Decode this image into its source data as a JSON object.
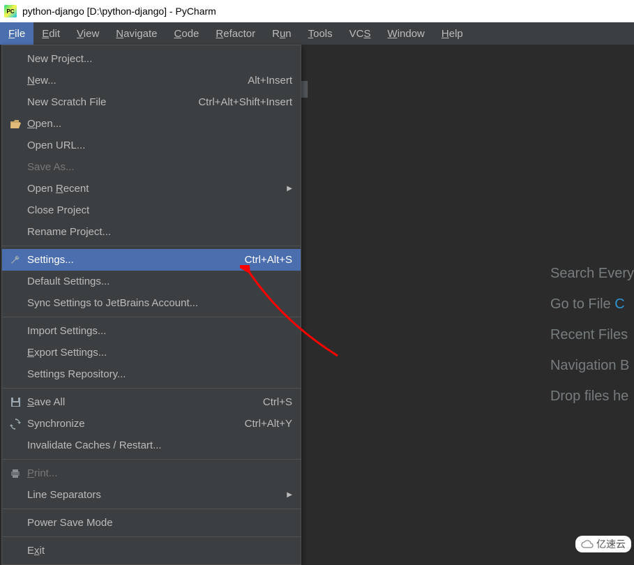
{
  "titlebar": {
    "app_icon_label": "PC",
    "text": "python-django [D:\\python-django] - PyCharm"
  },
  "menubar": {
    "file": "File",
    "file_u": "F",
    "file_rest": "ile",
    "edit": "Edit",
    "edit_u": "E",
    "edit_rest": "dit",
    "view": "View",
    "view_u": "V",
    "view_rest": "iew",
    "navigate": "Navigate",
    "nav_u": "N",
    "nav_rest": "avigate",
    "code": "Code",
    "code_u": "C",
    "code_rest": "ode",
    "refactor": "Refactor",
    "ref_u": "R",
    "ref_rest": "efactor",
    "run": "Run",
    "run_pre": "R",
    "run_u": "u",
    "run_rest": "n",
    "tools": "Tools",
    "tools_u": "T",
    "tools_rest": "ools",
    "vcs": "VCS",
    "vcs_pre": "VC",
    "vcs_u": "S",
    "window": "Window",
    "win_u": "W",
    "win_rest": "indow",
    "help": "Help",
    "help_u": "H",
    "help_rest": "elp"
  },
  "menu": {
    "new_project": "New Project...",
    "new": "New...",
    "new_u": "N",
    "new_rest": "ew...",
    "new_sc": "Alt+Insert",
    "new_scratch": "New Scratch File",
    "new_scratch_sc": "Ctrl+Alt+Shift+Insert",
    "open": "Open...",
    "open_u": "O",
    "open_rest": "pen...",
    "open_url": "Open URL...",
    "save_as": "Save As...",
    "open_recent_pre": "Open ",
    "open_recent_u": "R",
    "open_recent_rest": "ecent",
    "close_project": "Close Project",
    "rename_project": "Rename Project...",
    "settings": "Settings...",
    "settings_sc": "Ctrl+Alt+S",
    "default_settings": "Default Settings...",
    "sync_settings": "Sync Settings to JetBrains Account...",
    "import_settings": "Import Settings...",
    "export_settings_u": "E",
    "export_settings_rest": "xport Settings...",
    "settings_repo": "Settings Repository...",
    "save_all_u": "S",
    "save_all_rest": "ave All",
    "save_all_sc": "Ctrl+S",
    "synchronize": "Synchronize",
    "synchronize_sc": "Ctrl+Alt+Y",
    "invalidate": "Invalidate Caches / Restart...",
    "print_u": "P",
    "print_rest": "rint...",
    "line_sep": "Line Separators",
    "power_save": "Power Save Mode",
    "exit_pre": "E",
    "exit_u": "x",
    "exit_rest": "it"
  },
  "welcome": {
    "l1": "Search Every",
    "l2a": "Go to File  ",
    "l2b": "C",
    "l3": "Recent Files",
    "l4": "Navigation B",
    "l5": "Drop files he"
  },
  "watermark": {
    "text": "亿速云"
  }
}
